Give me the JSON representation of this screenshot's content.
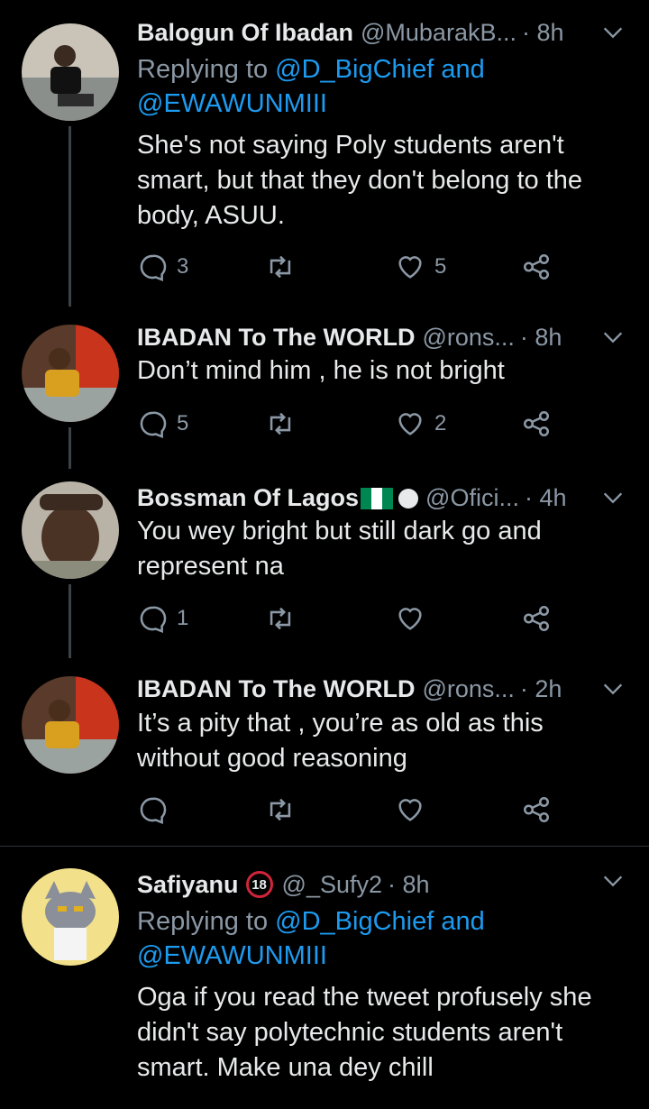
{
  "tweets": [
    {
      "name": "Balogun Of Ibadan",
      "handle": "@MubarakB...",
      "time": "· 8h",
      "replying_prefix": "Replying to ",
      "replying_mentions": "@D_BigChief and @EWAWUNMIII",
      "reply_line1": "@D_BigChief and",
      "reply_line2": "@EWAWUNMIII",
      "text": "She's not saying Poly students aren't smart, but that they don't belong to the body, ASUU.",
      "replies": "3",
      "retweets": "",
      "likes": "5"
    },
    {
      "name": "IBADAN To The WORLD",
      "handle": "@rons...",
      "time": "· 8h",
      "text": "Don’t mind him , he is not bright",
      "replies": "5",
      "retweets": "",
      "likes": "2"
    },
    {
      "name": "Bossman Of Lagos",
      "handle": "@Ofici...",
      "time": "· 4h",
      "text": "You wey bright but still dark go and represent na",
      "replies": "1",
      "retweets": "",
      "likes": ""
    },
    {
      "name": "IBADAN To The WORLD",
      "handle": "@rons...",
      "time": "· 2h",
      "text": "It’s a pity that , you’re as old as this without good reasoning",
      "replies": "",
      "retweets": "",
      "likes": ""
    },
    {
      "name": "Safiyanu",
      "handle": "@_Sufy2",
      "time": "· 8h",
      "age_badge": "18",
      "replying_prefix": "Replying to ",
      "reply_line1": "@D_BigChief and",
      "reply_line2": "@EWAWUNMIII",
      "text": "Oga if you read the tweet profusely she didn't say polytechnic students aren't smart. Make una dey chill"
    }
  ],
  "icons": {
    "reply": "reply-icon",
    "retweet": "retweet-icon",
    "like": "heart-icon",
    "share": "share-icon",
    "caret": "chevron-down-icon"
  },
  "colors": {
    "background": "#000000",
    "text": "#e7e9ea",
    "muted": "#8b98a5",
    "link": "#1d9bf0",
    "thread": "#3d4247"
  }
}
